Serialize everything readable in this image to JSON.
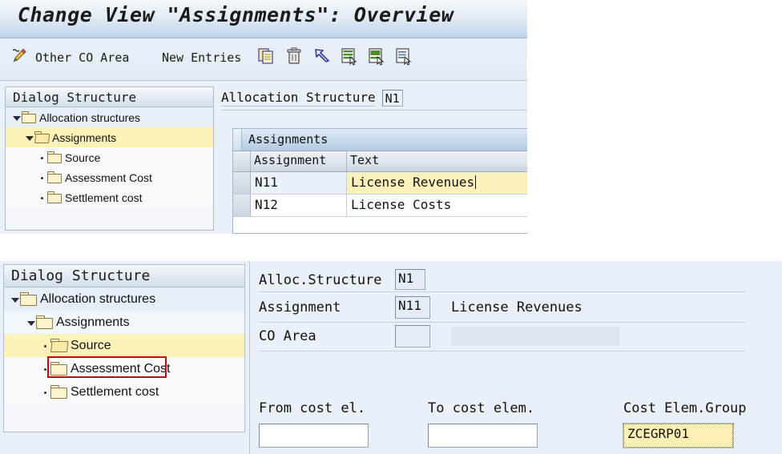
{
  "window": {
    "title": "Change View \"Assignments\": Overview"
  },
  "toolbar": {
    "items": [
      {
        "name": "display-change-icon",
        "label": "",
        "icon": "pencil-edit-icon"
      },
      {
        "name": "other-co-area-button",
        "label": "Other CO Area",
        "icon": ""
      },
      {
        "name": "new-entries-button",
        "label": "New Entries",
        "icon": ""
      },
      {
        "name": "copy-icon",
        "label": "",
        "icon": "copy-document-icon"
      },
      {
        "name": "delete-icon",
        "label": "",
        "icon": "trash-can-icon"
      },
      {
        "name": "undo-icon",
        "label": "",
        "icon": "undo-arrow-icon"
      },
      {
        "name": "select-all-icon",
        "label": "",
        "icon": "table-select-icon"
      },
      {
        "name": "select-block-icon",
        "label": "",
        "icon": "table-block-icon"
      },
      {
        "name": "details-icon",
        "label": "",
        "icon": "table-details-icon"
      }
    ]
  },
  "top_panel": {
    "tree": {
      "header": "Dialog Structure",
      "items": [
        {
          "label": "Allocation structures",
          "level": 0,
          "twisty": "caret",
          "folder": "closed",
          "selected": false
        },
        {
          "label": "Assignments",
          "level": 1,
          "twisty": "caret",
          "folder": "open",
          "selected": true
        },
        {
          "label": "Source",
          "level": 2,
          "twisty": "dot",
          "folder": "closed",
          "selected": false
        },
        {
          "label": "Assessment Cost",
          "level": 2,
          "twisty": "dot",
          "folder": "closed",
          "selected": false
        },
        {
          "label": "Settlement cost",
          "level": 2,
          "twisty": "dot",
          "folder": "closed",
          "selected": false
        }
      ]
    },
    "alloc_structure": {
      "label": "Allocation Structure",
      "value": "N1"
    },
    "grid": {
      "title": "Assignments",
      "columns": [
        "Assignment",
        "Text"
      ],
      "rows": [
        {
          "assignment": "N11",
          "text": "License Revenues",
          "active": true
        },
        {
          "assignment": "N12",
          "text": "License Costs",
          "active": false
        }
      ]
    }
  },
  "bottom_panel": {
    "tree": {
      "header": "Dialog Structure",
      "items": [
        {
          "label": "Allocation structures",
          "level": 0,
          "twisty": "caret",
          "folder": "closed",
          "selected": false
        },
        {
          "label": "Assignments",
          "level": 1,
          "twisty": "caret",
          "folder": "closed",
          "selected": false
        },
        {
          "label": "Source",
          "level": 2,
          "twisty": "dot",
          "folder": "open",
          "selected": true
        },
        {
          "label": "Assessment Cost",
          "level": 2,
          "twisty": "dot",
          "folder": "closed",
          "selected": false
        },
        {
          "label": "Settlement cost",
          "level": 2,
          "twisty": "dot",
          "folder": "closed",
          "selected": false
        }
      ]
    },
    "fields": {
      "alloc_structure_label": "Alloc.Structure",
      "alloc_structure_value": "N1",
      "assignment_label": "Assignment",
      "assignment_value": "N11",
      "assignment_text": "License Revenues",
      "co_area_label": "CO Area",
      "co_area_value": "",
      "co_area_text": ""
    },
    "cost_elements": {
      "from_label": "From cost el.",
      "from_value": "",
      "to_label": "To cost elem.",
      "to_value": "",
      "group_label": "Cost Elem.Group",
      "group_value": "ZCEGRP01"
    }
  },
  "colors": {
    "selection_yellow": "#fdf3b8",
    "annotation_red": "#cc0000",
    "panel_blue": "#e9f0f8"
  }
}
